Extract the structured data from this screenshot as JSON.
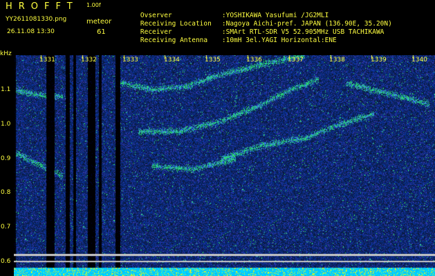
{
  "header": {
    "title": "HROFFT",
    "version": "1.00f",
    "filename": "YY2611081330.png",
    "meteor_label": "meteor",
    "datetime": "26.11.08 13:30",
    "meteor_count": "61"
  },
  "info": [
    {
      "key": "Ovserver",
      "value": ":YOSHIKAWA Yasufumi /JG2MLI"
    },
    {
      "key": "Receiving Location",
      "value": ":Nagoya Aichi-pref. JAPAN (136.90E, 35.20N)"
    },
    {
      "key": "Receiver",
      "value": ":SMArt RTL-SDR V5 52.905MHz USB TACHIKAWA"
    },
    {
      "key": "Receiving Antenna",
      "value": ":10mH 3el.YAGI Horizontal:ENE"
    }
  ],
  "axis": {
    "unit": "kHz",
    "y_ticks": [
      "1.1",
      "1.0",
      "0.9",
      "0.8",
      "0.7",
      "0.6"
    ],
    "x_ticks": [
      "1331",
      "1332",
      "1333",
      "1334",
      "1335",
      "1336",
      "1337",
      "1338",
      "1339",
      "1340"
    ]
  },
  "colors": {
    "text": "#ffff40",
    "background": "#000000",
    "noise": "#1428b4",
    "signal": "#40ff80",
    "baseline": "#00c8ff"
  }
}
